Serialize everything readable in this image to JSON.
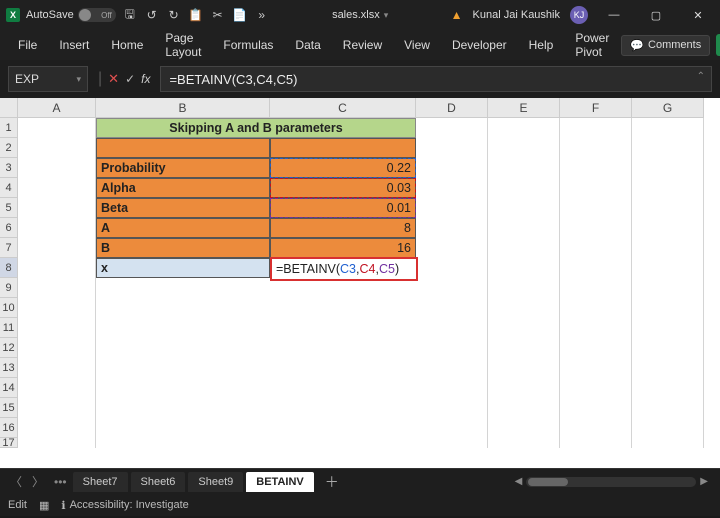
{
  "titlebar": {
    "autosave_label": "AutoSave",
    "autosave_state": "Off",
    "filename": "sales.xlsx",
    "user_name": "Kunal Jai Kaushik",
    "user_initials": "KJ"
  },
  "ribbon": {
    "tabs": [
      "File",
      "Insert",
      "Home",
      "Page Layout",
      "Formulas",
      "Data",
      "Review",
      "View",
      "Developer",
      "Help",
      "Power Pivot"
    ],
    "comments_label": "Comments"
  },
  "formula": {
    "namebox": "EXP",
    "fx": "fx",
    "text": "=BETAINV(C3,C4,C5)"
  },
  "columns": [
    "A",
    "B",
    "C",
    "D",
    "E",
    "F",
    "G"
  ],
  "rows": [
    "1",
    "2",
    "3",
    "4",
    "5",
    "6",
    "7",
    "8",
    "9",
    "10",
    "11",
    "12",
    "13",
    "14",
    "15",
    "16",
    "17"
  ],
  "cells": {
    "header_title": "Skipping A and B parameters",
    "b3": "Probability",
    "c3": "0.22",
    "b4": "Alpha",
    "c4": "0.03",
    "b5": "Beta",
    "c5": "0.01",
    "b6": "A",
    "c6": "8",
    "b7": "B",
    "c7": "16",
    "b8": "x",
    "c8_prefix": "=BETAINV(",
    "c8_r1": "C3",
    "c8_c1": ",",
    "c8_r2": "C4",
    "c8_c2": ",",
    "c8_r3": "C5",
    "c8_suffix": ")"
  },
  "tabs": {
    "sheets": [
      "Sheet7",
      "Sheet6",
      "Sheet9"
    ],
    "active": "BETAINV"
  },
  "status": {
    "mode": "Edit",
    "accessibility": "Accessibility: Investigate"
  }
}
